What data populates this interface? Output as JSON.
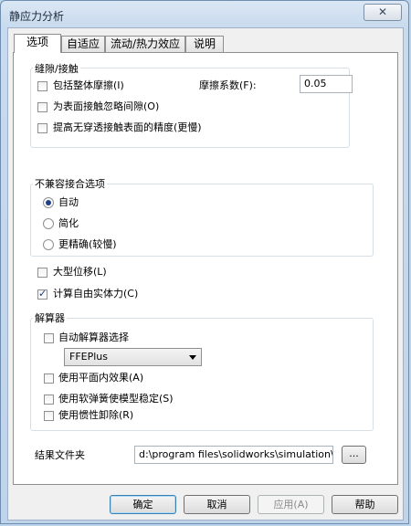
{
  "window": {
    "title": "静应力分析",
    "close_label": "✕"
  },
  "tabs": [
    {
      "label": "选项"
    },
    {
      "label": "自适应"
    },
    {
      "label": "流动/热力效应"
    },
    {
      "label": "说明"
    }
  ],
  "gap_contact": {
    "title": "缝隙/接触",
    "include_friction": {
      "label": "包括整体摩擦(I)",
      "checked": false
    },
    "friction_label": "摩擦系数(F):",
    "friction_value": "0.05",
    "ignore_gap": {
      "label": "为表面接触忽略间隙(O)",
      "checked": false
    },
    "improve_accuracy": {
      "label": "提高无穿透接触表面的精度(更慢)",
      "checked": false
    }
  },
  "incompatible": {
    "title": "不兼容接合选项",
    "options": [
      {
        "label": "自动",
        "checked": true
      },
      {
        "label": "简化",
        "checked": false
      },
      {
        "label": "更精确(较慢)",
        "checked": false
      }
    ]
  },
  "large_displacement": {
    "label": "大型位移(L)",
    "checked": false
  },
  "free_body": {
    "label": "计算自由实体力(C)",
    "checked": true
  },
  "solver": {
    "title": "解算器",
    "auto_select": {
      "label": "自动解算器选择",
      "checked": false
    },
    "selected": "FFEPlus",
    "inplane": {
      "label": "使用平面内效果(A)",
      "checked": false
    },
    "soft_spring": {
      "label": "使用软弹簧使模型稳定(S)",
      "checked": false
    },
    "inertial_relief": {
      "label": "使用惯性卸除(R)",
      "checked": false
    }
  },
  "result_folder": {
    "label": "结果文件夹",
    "value": "d:\\program files\\solidworks\\simulation\\E:",
    "browse_label": "..."
  },
  "buttons": {
    "ok": "确定",
    "cancel": "取消",
    "apply": "应用(A)",
    "help": "帮助"
  }
}
